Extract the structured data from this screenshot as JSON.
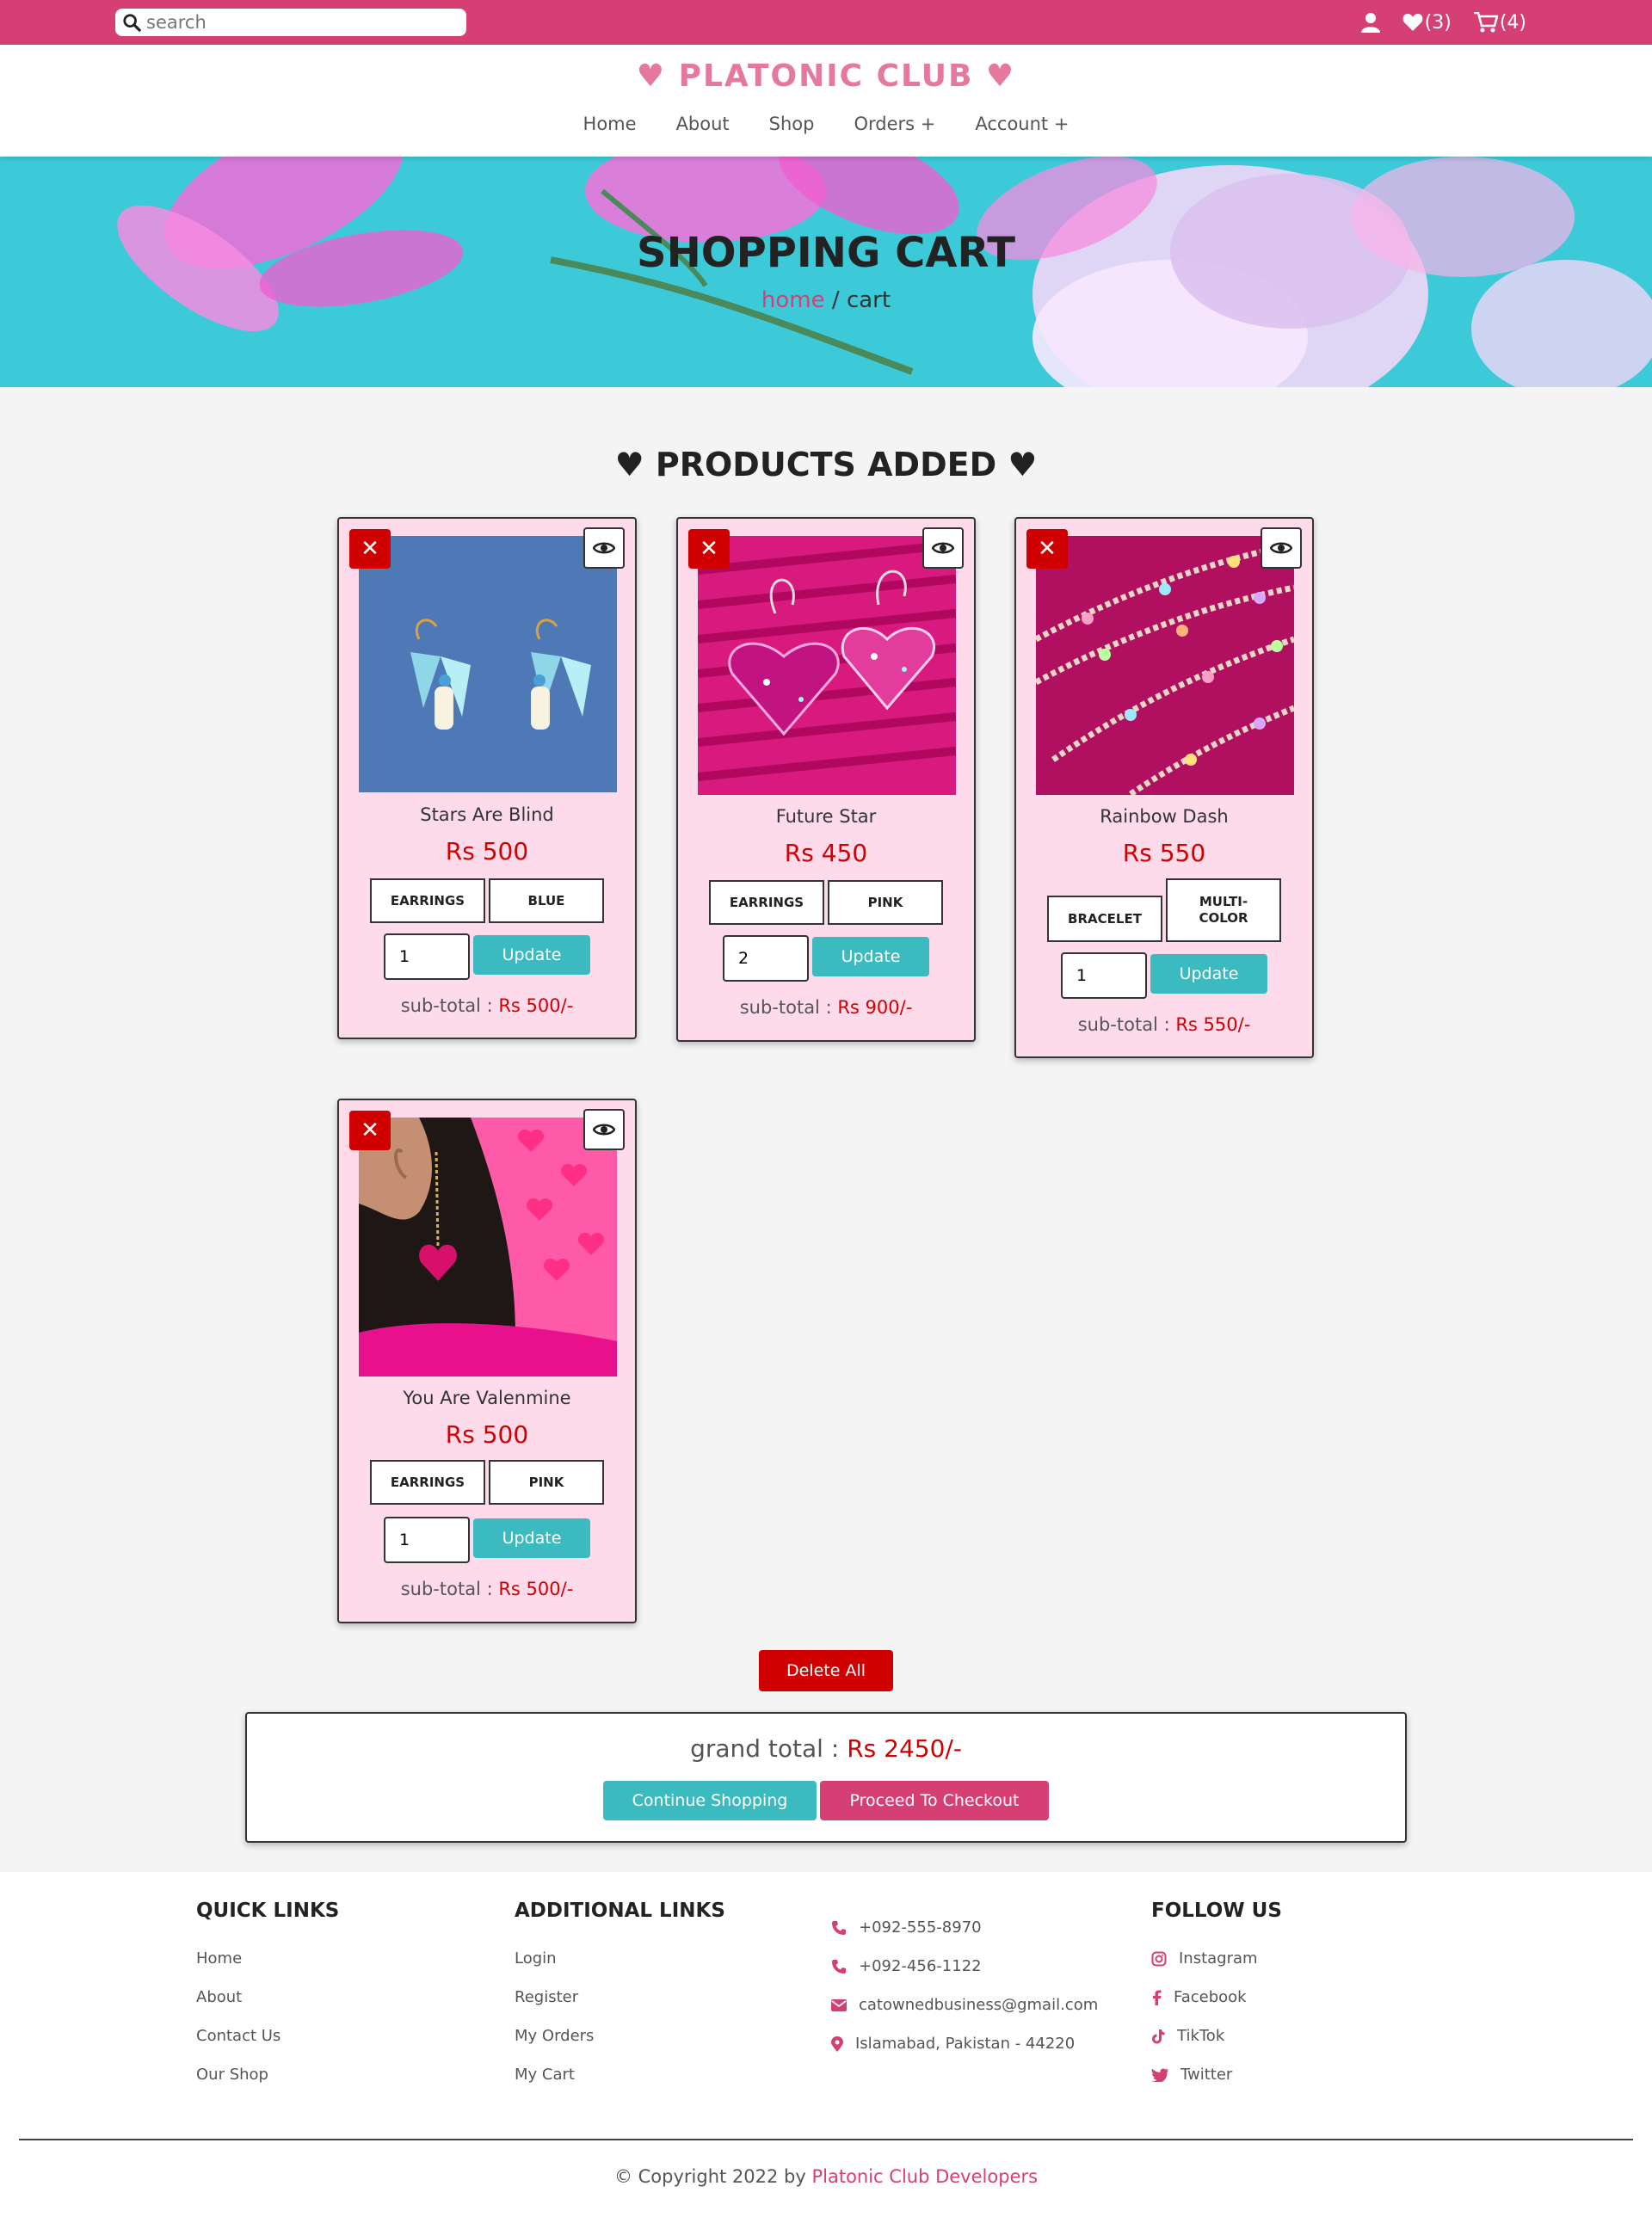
{
  "topbar": {
    "search_placeholder": "search",
    "wishlist_count": "(3)",
    "cart_count": "(4)"
  },
  "header": {
    "logo": "♥ PLATONIC CLUB ♥",
    "nav": [
      "Home",
      "About",
      "Shop",
      "Orders +",
      "Account +"
    ]
  },
  "hero": {
    "title": "SHOPPING CART",
    "crumb_home": "home",
    "crumb_sep": " / ",
    "crumb_current": "cart"
  },
  "section_title": "♥ PRODUCTS ADDED ♥",
  "products": [
    {
      "name": "Stars Are Blind",
      "price": "Rs 500",
      "tag1": "EARRINGS",
      "tag2": "BLUE",
      "qty": "1",
      "update": "Update",
      "subtotal_label": "sub-total : ",
      "subtotal": "Rs 500/-"
    },
    {
      "name": "Future Star",
      "price": "Rs 450",
      "tag1": "EARRINGS",
      "tag2": "PINK",
      "qty": "2",
      "update": "Update",
      "subtotal_label": "sub-total : ",
      "subtotal": "Rs 900/-"
    },
    {
      "name": "Rainbow Dash",
      "price": "Rs 550",
      "tag1": "BRACELET",
      "tag2": "MULTI-COLOR",
      "qty": "1",
      "update": "Update",
      "subtotal_label": "sub-total : ",
      "subtotal": "Rs 550/-"
    },
    {
      "name": "You Are Valenmine",
      "price": "Rs 500",
      "tag1": "EARRINGS",
      "tag2": "PINK",
      "qty": "1",
      "update": "Update",
      "subtotal_label": "sub-total : ",
      "subtotal": "Rs 500/-"
    }
  ],
  "delete_all": "Delete All",
  "total": {
    "label": "grand total : ",
    "amount": "Rs 2450/-",
    "continue": "Continue Shopping",
    "checkout": "Proceed To Checkout"
  },
  "footer": {
    "quick_title": "QUICK LINKS",
    "quick_links": [
      "Home",
      "About",
      "Contact Us",
      "Our Shop"
    ],
    "additional_title": "ADDITIONAL LINKS",
    "additional_links": [
      "Login",
      "Register",
      "My Orders",
      "My Cart"
    ],
    "contact": [
      "+092-555-8970",
      "+092-456-1122",
      "catownedbusiness@gmail.com",
      "Islamabad, Pakistan - 44220"
    ],
    "follow_title": "FOLLOW US",
    "social": [
      "Instagram",
      "Facebook",
      "TikTok",
      "Twitter"
    ],
    "copyright_prefix": "© Copyright 2022 by ",
    "copyright_name": "Platonic Club Developers"
  },
  "colors": {
    "brand_pink": "#d63f73",
    "logo_pink": "#e5789d",
    "card_bg": "#fedbeb",
    "accent_teal": "#3bbbc0",
    "danger_red": "#d00000",
    "hero_cyan": "#3ccad9"
  },
  "icons": [
    "search-icon",
    "user-icon",
    "heart-icon",
    "cart-icon",
    "close-icon",
    "eye-icon",
    "phone-icon",
    "envelope-icon",
    "map-marker-icon",
    "instagram-icon",
    "facebook-icon",
    "tiktok-icon",
    "twitter-icon"
  ]
}
